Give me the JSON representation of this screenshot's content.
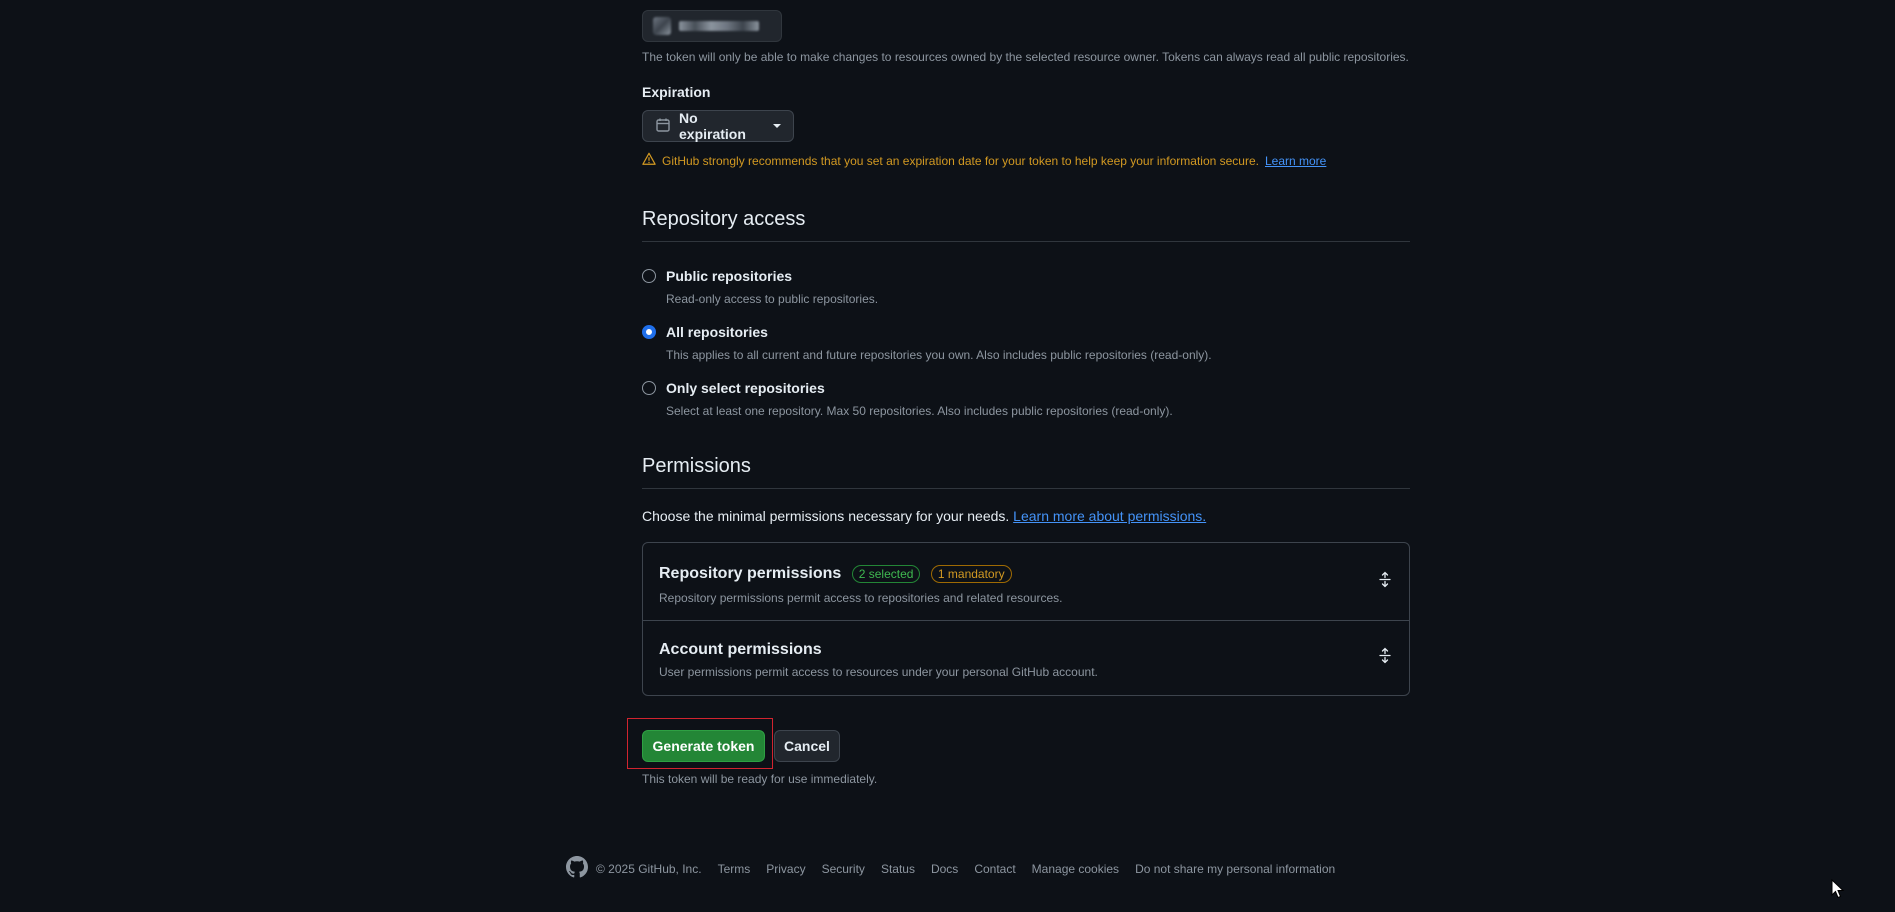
{
  "owner": {
    "help": "The token will only be able to make changes to resources owned by the selected resource owner. Tokens can always read all public repositories."
  },
  "expiration": {
    "label": "Expiration",
    "value": "No expiration",
    "warning": "GitHub strongly recommends that you set an expiration date for your token to help keep your information secure.",
    "learn_more": "Learn more"
  },
  "repo_access": {
    "title": "Repository access",
    "options": [
      {
        "label": "Public repositories",
        "desc": "Read-only access to public repositories.",
        "checked": false
      },
      {
        "label": "All repositories",
        "desc": "This applies to all current and future repositories you own. Also includes public repositories (read-only).",
        "checked": true
      },
      {
        "label": "Only select repositories",
        "desc": "Select at least one repository. Max 50 repositories. Also includes public repositories (read-only).",
        "checked": false
      }
    ]
  },
  "permissions": {
    "title": "Permissions",
    "intro": "Choose the minimal permissions necessary for your needs.",
    "intro_link": "Learn more about permissions.",
    "groups": [
      {
        "title": "Repository permissions",
        "desc": "Repository permissions permit access to repositories and related resources.",
        "badge_selected": "2 selected",
        "badge_mandatory": "1 mandatory"
      },
      {
        "title": "Account permissions",
        "desc": "User permissions permit access to resources under your personal GitHub account."
      }
    ]
  },
  "actions": {
    "generate": "Generate token",
    "cancel": "Cancel",
    "note": "This token will be ready for use immediately."
  },
  "footer": {
    "copyright": "© 2025 GitHub, Inc.",
    "links": [
      "Terms",
      "Privacy",
      "Security",
      "Status",
      "Docs",
      "Contact",
      "Manage cookies",
      "Do not share my personal information"
    ]
  },
  "colors": {
    "background": "#0d1117",
    "accent_blue": "#4493f8",
    "primary_green": "#238636",
    "warning": "#d29922",
    "highlight_red": "#d1242f"
  },
  "icons": {
    "calendar": "calendar-icon",
    "warning": "alert-icon",
    "expand": "unfold-icon",
    "github": "github-mark-icon"
  }
}
